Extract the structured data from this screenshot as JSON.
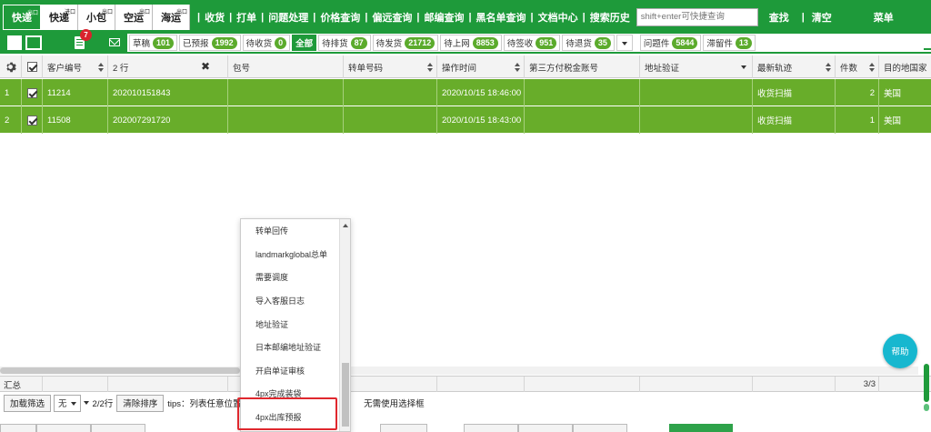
{
  "topbar": {
    "services": [
      {
        "label": "快递",
        "sup": "出口",
        "active": true
      },
      {
        "label": "快递",
        "sup": "进口",
        "active": false
      },
      {
        "label": "小包",
        "sup": "出口",
        "active": false
      },
      {
        "label": "空运",
        "sup": "出口",
        "active": false
      },
      {
        "label": "海运",
        "sup": "出口",
        "active": false
      }
    ],
    "links": [
      "收货",
      "打单",
      "问题处理",
      "价格查询",
      "偏远查询",
      "邮编查询",
      "黑名单查询",
      "文档中心",
      "搜索历史"
    ],
    "search_placeholder": "shift+enter可快捷查询",
    "find_label": "查找",
    "clear_label": "清空",
    "menu_label": "菜单",
    "sep": "|"
  },
  "filterbar": {
    "notify_count": "7",
    "chips": [
      {
        "label": "草稿",
        "count": "101"
      },
      {
        "label": "已预报",
        "count": "1992"
      },
      {
        "label": "待收货",
        "count": "0"
      },
      {
        "label": "全部",
        "count": ""
      },
      {
        "label": "待排货",
        "count": "87"
      },
      {
        "label": "待发货",
        "count": "21712"
      },
      {
        "label": "待上网",
        "count": "8853"
      },
      {
        "label": "待签收",
        "count": "951"
      },
      {
        "label": "待退货",
        "count": "35"
      },
      {
        "label": "问题件",
        "count": "5844"
      },
      {
        "label": "滞留件",
        "count": "13"
      }
    ]
  },
  "grid": {
    "headers": {
      "customer_no": "客户编号",
      "rows_count": "2 行",
      "package_no": "包号",
      "transfer_no": "转单号码",
      "op_time": "操作时间",
      "tax_account": "第三方付税金账号",
      "addr_verify": "地址验证",
      "latest_track": "最新轨迹",
      "pieces": "件数",
      "destination": "目的地国家"
    },
    "rows": [
      {
        "index": "1",
        "customer_no": "11214",
        "order_no": "202010151843",
        "package_no": "",
        "transfer_no": "",
        "op_time": "2020/10/15 18:46:00",
        "tax_account": "",
        "addr_verify": "",
        "latest_track": "收货扫描",
        "pieces": "2",
        "destination": "美国"
      },
      {
        "index": "2",
        "customer_no": "11508",
        "order_no": "202007291720",
        "package_no": "",
        "transfer_no": "",
        "op_time": "2020/10/15 18:43:00",
        "tax_account": "",
        "addr_verify": "",
        "latest_track": "收货扫描",
        "pieces": "1",
        "destination": "美国"
      }
    ]
  },
  "menu": {
    "items": [
      "转单回传",
      "landmarkglobal总单",
      "需要调度",
      "导入客服日志",
      "地址验证",
      "日本邮编地址验证",
      "开启单证审核",
      "4px完成装袋",
      "4px出库预报"
    ]
  },
  "summary": {
    "label": "汇总",
    "page": "3/3"
  },
  "bottom": {
    "load_filter": "加载筛选",
    "select_value": "无",
    "rows_text": "2/2行",
    "clear_sort": "清除排序",
    "tips": "tips：列表任意位置，",
    "tips_tail": "无需使用选择框"
  },
  "help_label": "帮助",
  "colors": {
    "nav_green": "#1e9a3a",
    "row_green": "#68ad2a",
    "badge_red": "#d9232d",
    "help_cyan": "#17b7cf",
    "highlight_red": "#e0282e"
  }
}
